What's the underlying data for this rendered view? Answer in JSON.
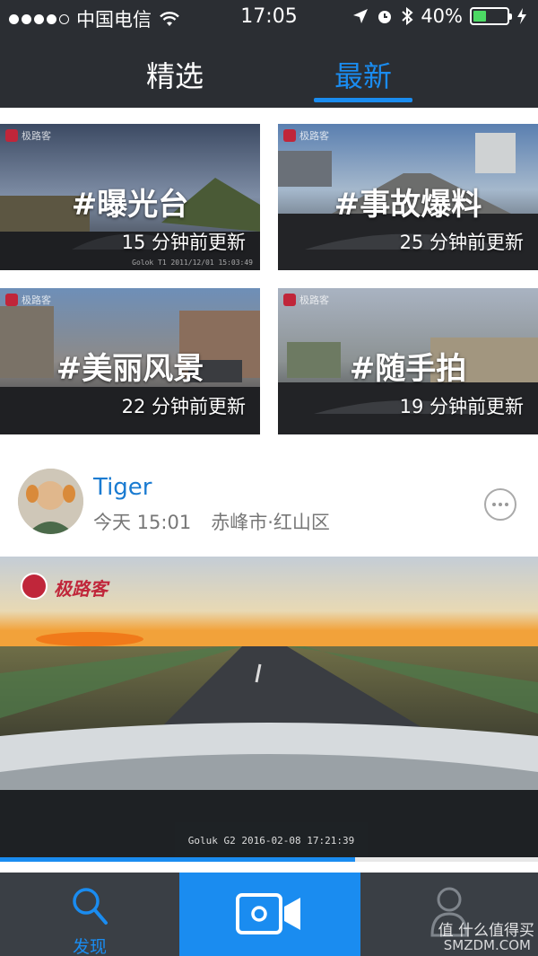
{
  "status_bar": {
    "carrier": "中国电信",
    "time": "17:05",
    "battery_percent": "40%",
    "battery_level": 0.4
  },
  "tabs": [
    {
      "label": "精选"
    },
    {
      "label": "最新"
    }
  ],
  "topics": [
    {
      "tag": "#曝光台",
      "updated": "15 分钟前更新",
      "stamp": "Golok T1 2011/12/01 15:03:49"
    },
    {
      "tag": "#事故爆料",
      "updated": "25 分钟前更新",
      "stamp": ""
    },
    {
      "tag": "#美丽风景",
      "updated": "22 分钟前更新",
      "stamp": ""
    },
    {
      "tag": "#随手拍",
      "updated": "19 分钟前更新",
      "stamp": ""
    }
  ],
  "brand": {
    "name": "极路客",
    "color": "#c0263a"
  },
  "post": {
    "username": "Tiger",
    "time": "今天 15:01",
    "location": "赤峰市·红山区",
    "video_stamp": "Goluk G2 2016-02-08 17:21:39",
    "progress": 0.66
  },
  "bottom_nav": {
    "discover_label": "发现"
  },
  "watermark": {
    "line1": "值 什么值得买",
    "line2": "SMZDM.COM"
  },
  "colors": {
    "accent": "#1a8cf0",
    "dark_bar": "#2b2e33"
  }
}
